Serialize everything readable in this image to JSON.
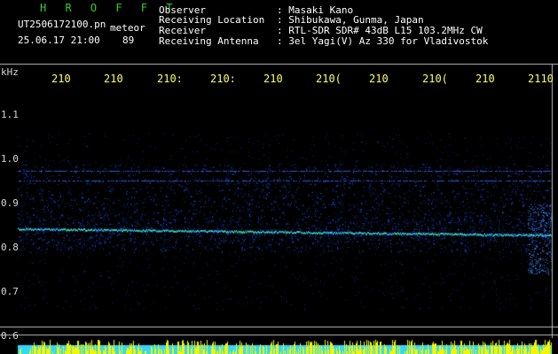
{
  "header": {
    "station": "H R O F F T",
    "filename": "UT2506172100.pn",
    "meteor_label": "meteor",
    "datetime": "25.06.17 21:00",
    "count": "89",
    "info_keys": [
      "Observer",
      "Receiving Location",
      "Receiver",
      "Receiving Antenna"
    ],
    "info_values": [
      ": Masaki Kano",
      ": Shibukawa, Gunma, Japan",
      ": RTL-SDR SDR# 43dB L15 103.2MHz CW",
      ": 3el Yagi(V) Az 330 for Vladivostok"
    ]
  },
  "axis": {
    "unit": "kHz",
    "y_ticks": [
      "1.1",
      "1.0",
      "0.9",
      "0.8",
      "0.7",
      "0.6"
    ],
    "x_ticks": [
      "210",
      "210",
      "210:",
      "210:",
      "210",
      "210(",
      "210",
      "210(",
      "210",
      "2110"
    ]
  },
  "colors": {
    "background": "#000000",
    "trace": "#2a6cff",
    "trace_bright": "#39e6a0",
    "bottom_bar_cyan": "#30d8ff",
    "bottom_bar_yellow": "#f5f500"
  }
}
